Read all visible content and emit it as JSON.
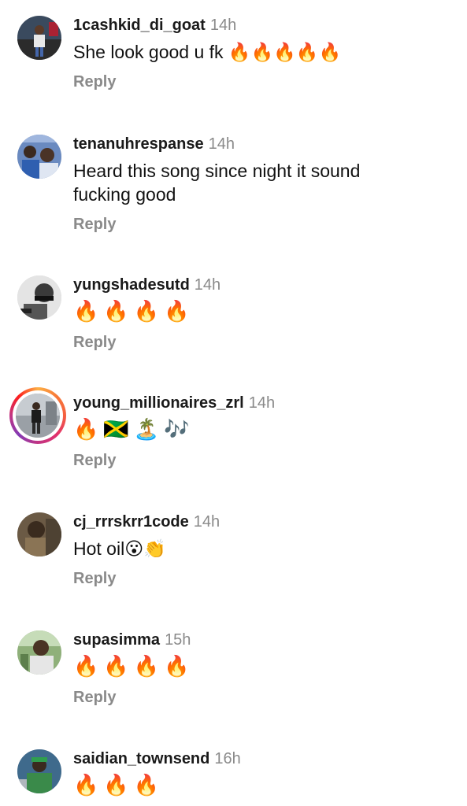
{
  "comments": [
    {
      "username": "1cashkid_di_goat",
      "time": "14h",
      "text": "She look good u fk 🔥🔥🔥🔥🔥",
      "reply_label": "Reply",
      "avatar": "avatar-photo"
    },
    {
      "username": "tenanuhrespanse",
      "time": "14h",
      "text": "Heard this song since night it sound fucking good",
      "reply_label": "Reply",
      "avatar": "avatar-photo"
    },
    {
      "username": "yungshadesutd",
      "time": "14h",
      "text": "🔥🔥🔥🔥",
      "reply_label": "Reply",
      "avatar": "avatar-photo"
    },
    {
      "username": "young_millionaires_zrl",
      "time": "14h",
      "text": "🔥🇯🇲🏝️🎶",
      "reply_label": "Reply",
      "avatar": "avatar-photo-story-ring"
    },
    {
      "username": "cj_rrrskrr1code",
      "time": "14h",
      "text": "Hot oil😮👏",
      "reply_label": "Reply",
      "avatar": "avatar-photo"
    },
    {
      "username": "supasimma",
      "time": "15h",
      "text": "🔥🔥🔥🔥",
      "reply_label": "Reply",
      "avatar": "avatar-photo"
    },
    {
      "username": "saidian_townsend",
      "time": "16h",
      "text": "🔥🔥🔥",
      "reply_label": "",
      "avatar": "avatar-photo"
    }
  ],
  "colors": {
    "username": "#1a1a1a",
    "meta_gray": "#8a8a8a",
    "story_ring_start": "#fcaf45",
    "story_ring_end": "#833ab4"
  }
}
